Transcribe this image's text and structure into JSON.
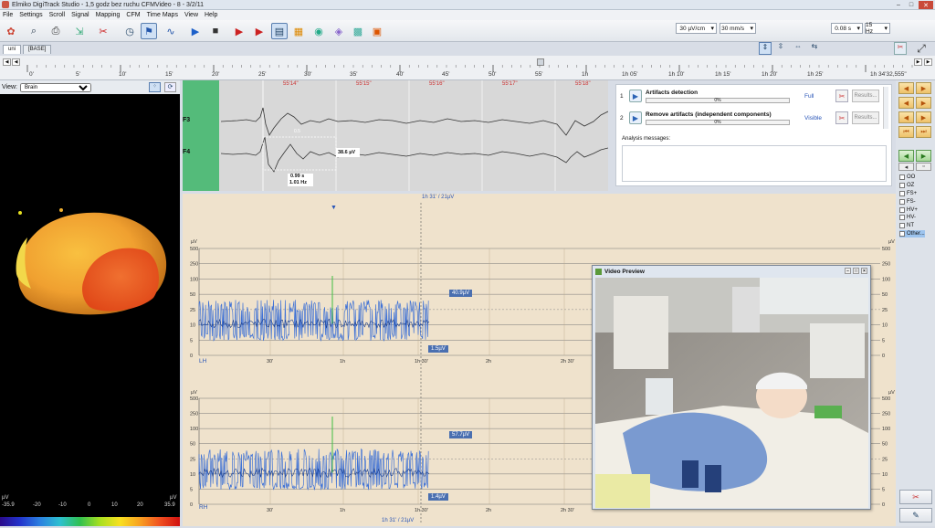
{
  "window": {
    "title": "Elmiko DigiTrack Studio  -  1,5 godz bez ruchu CFMVideo  -  8  -  3/2/11",
    "controls": [
      "–",
      "□",
      "✕"
    ]
  },
  "menu": [
    "File",
    "Settings",
    "Scroll",
    "Signal",
    "Mapping",
    "CFM",
    "Time Maps",
    "View",
    "Help"
  ],
  "toolbar": {
    "sensitivity": "30 µV/cm",
    "speed": "30 mm/s",
    "lowfilter": "0.08 s",
    "highfilter": "15 Hz"
  },
  "tabs": [
    "uni",
    "[BASE]"
  ],
  "ruler": {
    "labels": [
      "0'",
      "5'",
      "10'",
      "15'",
      "20'",
      "25'",
      "30'",
      "35'",
      "40'",
      "45'",
      "50'",
      "55'",
      "1h",
      "1h 05'",
      "1h 10'",
      "1h 15'",
      "1h 20'",
      "1h 25'",
      "1h 34'32,555\""
    ]
  },
  "leftpane": {
    "view_label": "View:",
    "view_value": "Brain",
    "scale_unit": "µV",
    "scale_ticks": [
      "-35.9",
      "-20",
      "-10",
      "0",
      "10",
      "20",
      "35.9"
    ]
  },
  "eeg": {
    "time_labels": [
      "55'14\"",
      "55'15\"",
      "55'16\"",
      "55'17\"",
      "55'18\""
    ],
    "channels": [
      "F3",
      "F4"
    ],
    "measure_amp": "38.6 µV",
    "measure_time": "0.99 s",
    "measure_freq": "1.01 Hz",
    "measure_small": "0.5"
  },
  "tasks": [
    {
      "num": "1",
      "name": "Artifacts detection",
      "progress": "0%",
      "mode": "Full",
      "results": "Results..."
    },
    {
      "num": "2",
      "name": "Remove artifacts (independent components)",
      "progress": "0%",
      "mode": "Visible",
      "results": "Results..."
    }
  ],
  "analysis_label": "Analysis messages:",
  "markers": [
    "OO",
    "OZ",
    "FS+",
    "FS-",
    "HV+",
    "HV-",
    "NT",
    "Other..."
  ],
  "trend": {
    "cursor_label": "1h 31' / 21µV",
    "unit": "µV",
    "y_ticks": [
      "500",
      "250",
      "100",
      "50",
      "25",
      "10",
      "5",
      "0"
    ],
    "x_ticks": [
      "30'",
      "1h",
      "1h 30'",
      "2h",
      "2h 30'"
    ],
    "lh": {
      "label": "LH",
      "max_value": "40.9µV",
      "min_value": "1.5µV"
    },
    "rh": {
      "label": "RH",
      "max_value": "57.7µV",
      "min_value": "1.4µV"
    }
  },
  "video": {
    "title": "Video Preview"
  }
}
